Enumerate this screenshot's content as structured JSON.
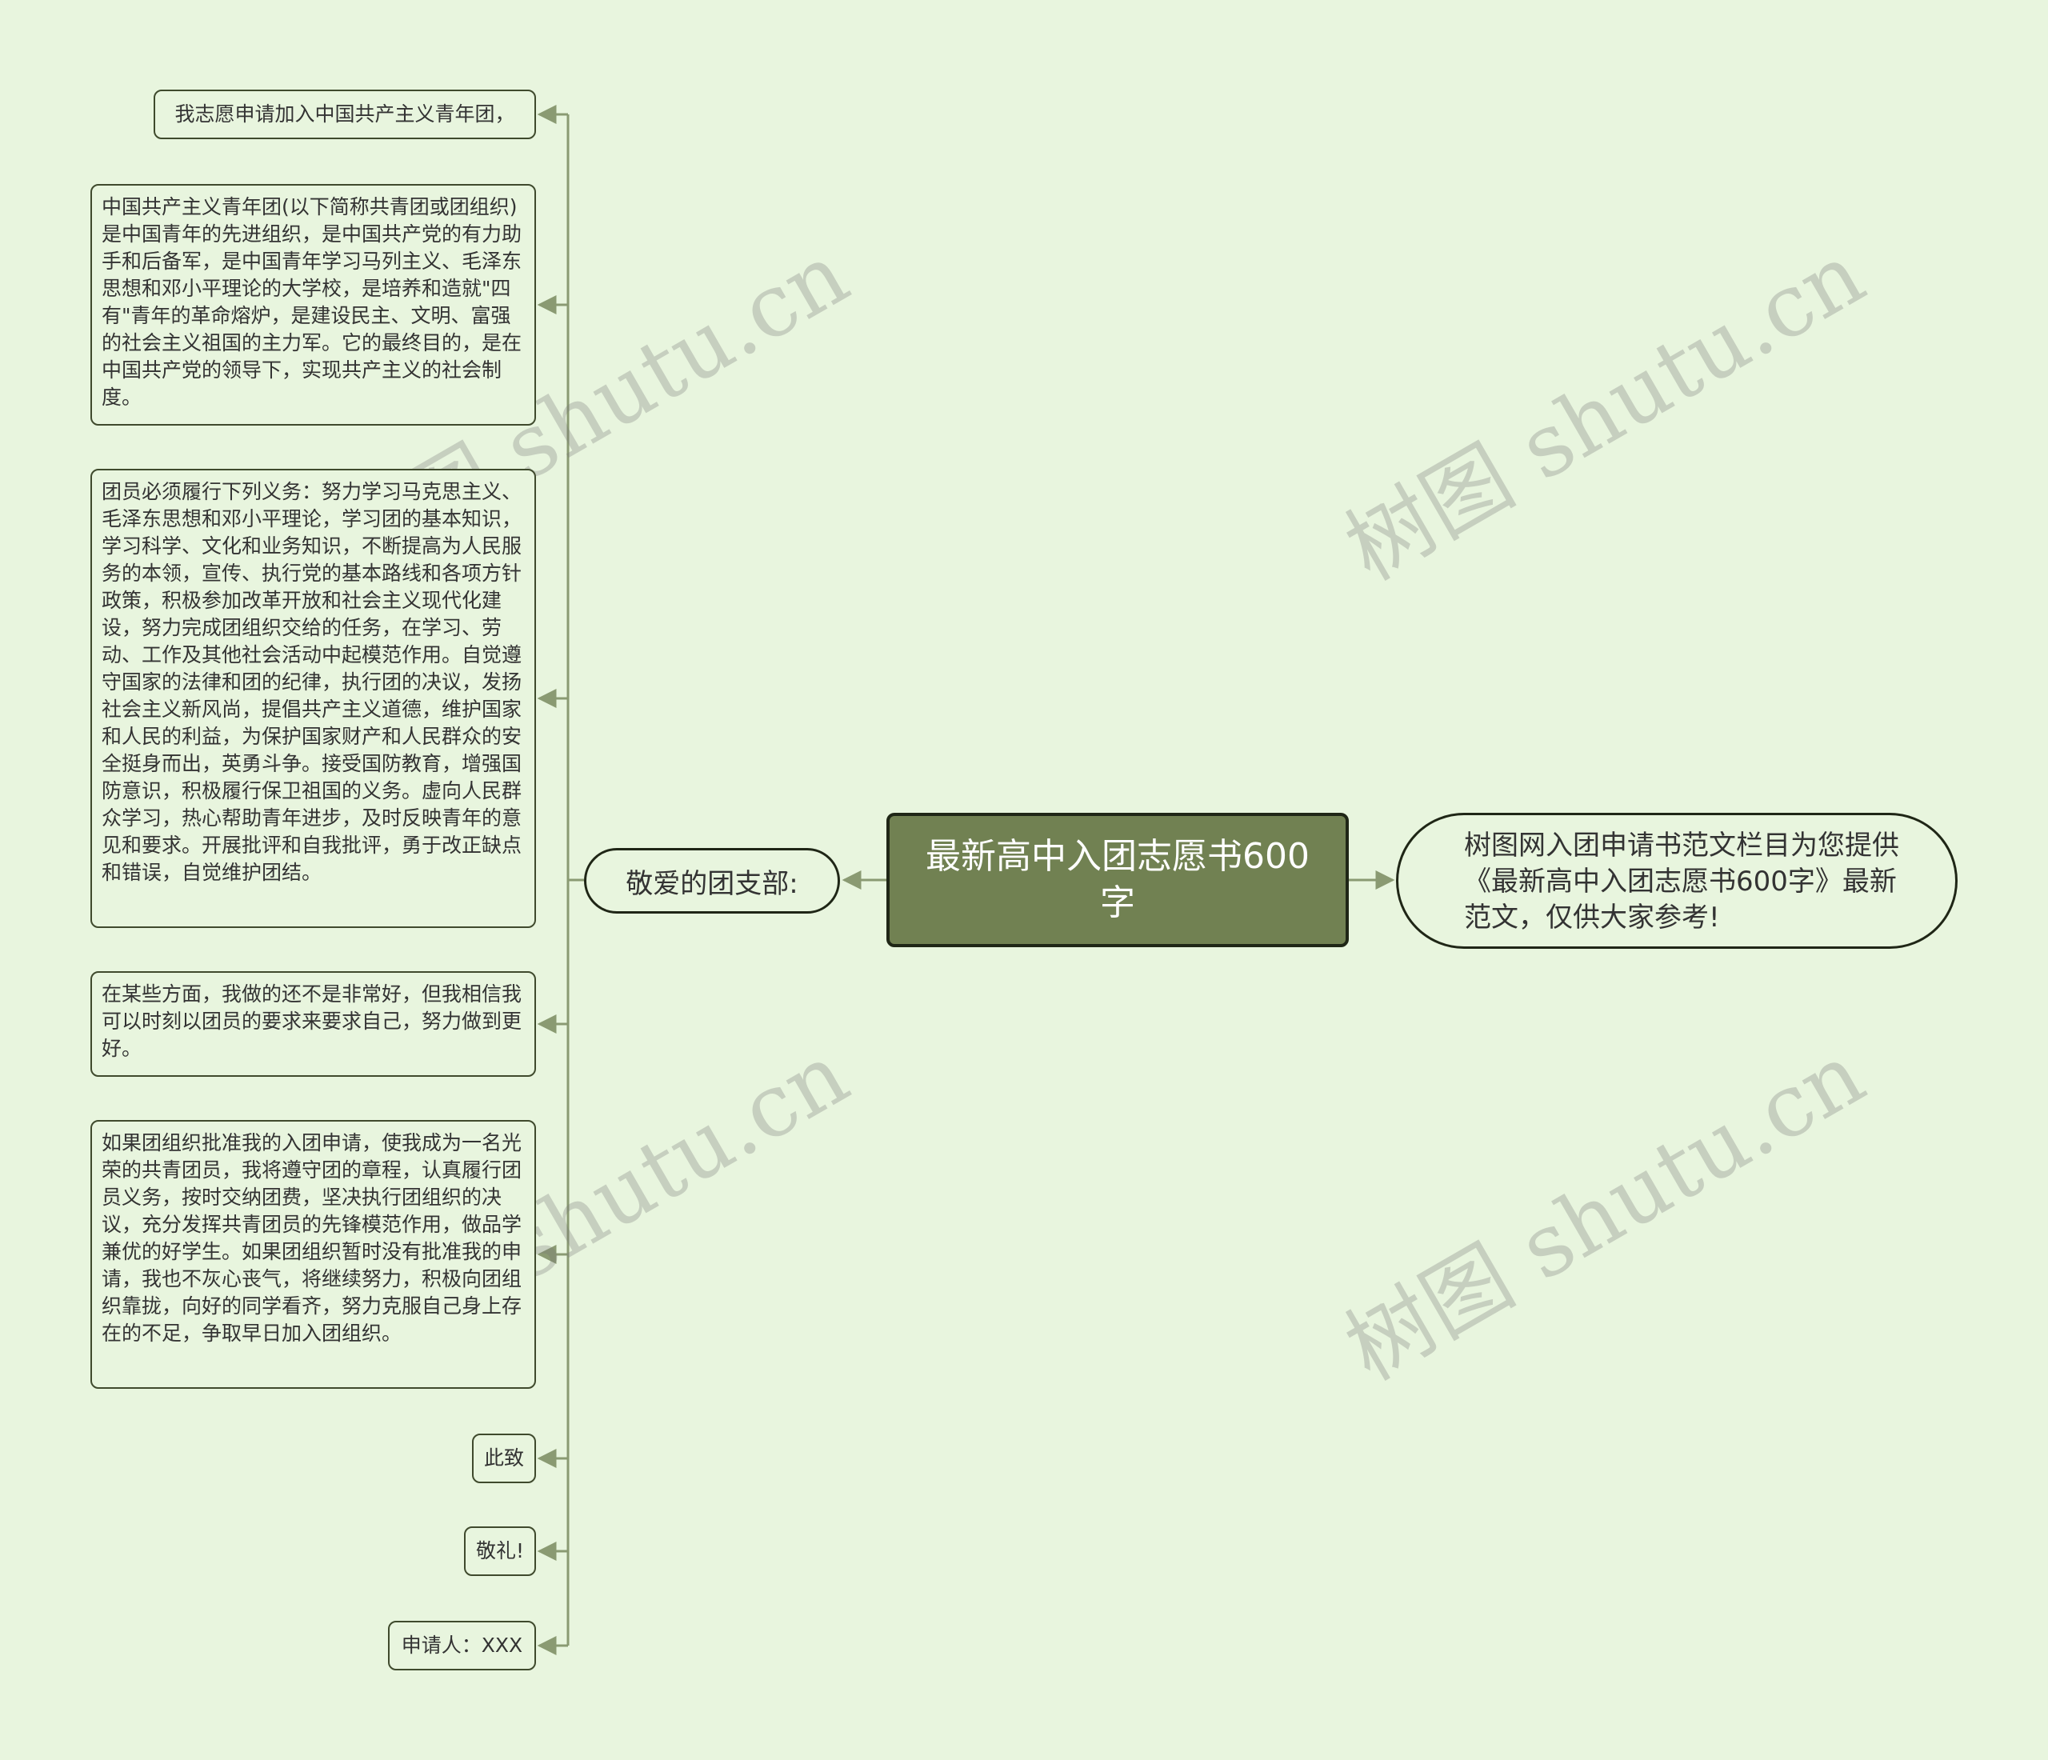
{
  "mindmap": {
    "root": "最新高中入团志愿书600字",
    "intro": "树图网入团申请书范文栏目为您提供《最新高中入团志愿书600字》最新范文，仅供大家参考!",
    "greeting": "敬爱的团支部:",
    "paragraphs": [
      "我志愿申请加入中国共产主义青年团，",
      "中国共产主义青年团(以下简称共青团或团组织)是中国青年的先进组织，是中国共产党的有力助手和后备军，是中国青年学习马列主义、毛泽东思想和邓小平理论的大学校，是培养和造就\"四有\"青年的革命熔炉，是建设民主、文明、富强的社会主义祖国的主力军。它的最终目的，是在中国共产党的领导下，实现共产主义的社会制度。",
      "团员必须履行下列义务：努力学习马克思主义、毛泽东思想和邓小平理论，学习团的基本知识，学习科学、文化和业务知识，不断提高为人民服务的本领，宣传、执行党的基本路线和各项方针政策，积极参加改革开放和社会主义现代化建设，努力完成团组织交给的任务，在学习、劳动、工作及其他社会活动中起模范作用。自觉遵守国家的法律和团的纪律，执行团的决议，发扬社会主义新风尚，提倡共产主义道德，维护国家和人民的利益，为保护国家财产和人民群众的安全挺身而出，英勇斗争。接受国防教育，增强国防意识，积极履行保卫祖国的义务。虚向人民群众学习，热心帮助青年进步，及时反映青年的意见和要求。开展批评和自我批评，勇于改正缺点和错误，自觉维护团结。",
      "在某些方面，我做的还不是非常好，但我相信我可以时刻以团员的要求来要求自己，努力做到更好。",
      "如果团组织批准我的入团申请，使我成为一名光荣的共青团员，我将遵守团的章程，认真履行团员义务，按时交纳团费，坚决执行团组织的决议，充分发挥共青团员的先锋模范作用，做品学兼优的好学生。如果团组织暂时没有批准我的申请，我也不灰心丧气，将继续努力，积极向团组织靠拢，向好的同学看齐，努力克服自己身上存在的不足，争取早日加入团组织。",
      "此致",
      "敬礼!",
      "申请人：XXX"
    ]
  },
  "watermark": "树图 shutu.cn",
  "colors": {
    "background": "#e8f5de",
    "root_fill": "#718152",
    "edge": "#8a9a72",
    "border": "#3f4a2d"
  }
}
